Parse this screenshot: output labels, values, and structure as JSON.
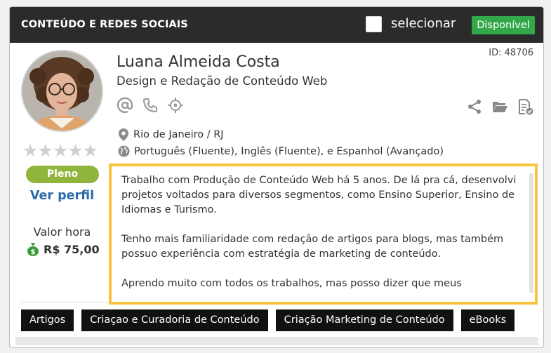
{
  "header": {
    "title": "CONTEÚDO E REDES SOCIAIS",
    "select_label": "selecionar",
    "status_badge": "Disponível"
  },
  "profile": {
    "name": "Luana Almeida Costa",
    "role": "Design e Redação de Conteúdo Web",
    "id_label": "ID: 48706",
    "rating_stars": 0,
    "rating_max": 5,
    "level": "Pleno",
    "view_profile": "Ver perfil",
    "rate_label": "Valor hora",
    "rate_value": "R$ 75,00",
    "location": "Rio de Janeiro / RJ",
    "languages": "Português (Fluente), Inglês (Fluente), e Espanhol (Avançado)"
  },
  "icons": {
    "contact": [
      "email-icon",
      "phone-icon",
      "location-target-icon"
    ],
    "actions": [
      "share-icon",
      "folder-icon",
      "document-check-icon"
    ],
    "info": [
      "map-pin-icon",
      "globe-icon"
    ],
    "rate": "money-bag-icon"
  },
  "description": {
    "paragraphs": [
      "Trabalho com Produção de Conteúdo Web há 5 anos. De lá pra cá, desenvolvi projetos voltados para diversos segmentos, como Ensino Superior, Ensino de Idiomas e Turismo.",
      "Tenho mais familiaridade com redação de artigos para blogs, mas também possuo experiência com estratégia de marketing de conteúdo.",
      "Aprendo muito com todos os trabalhos, mas posso dizer que meus"
    ]
  },
  "tags": [
    "Artigos",
    "Criaçao e Curadoria de Conteúdo",
    "Criação Marketing de Conteúdo",
    "eBooks"
  ],
  "colors": {
    "header_bg": "#2b2b2b",
    "available_green": "#32a84a",
    "level_green": "#8fb53c",
    "link_blue": "#2a6aa8",
    "highlight_yellow": "#f7c43b",
    "tag_bg": "#111111"
  }
}
